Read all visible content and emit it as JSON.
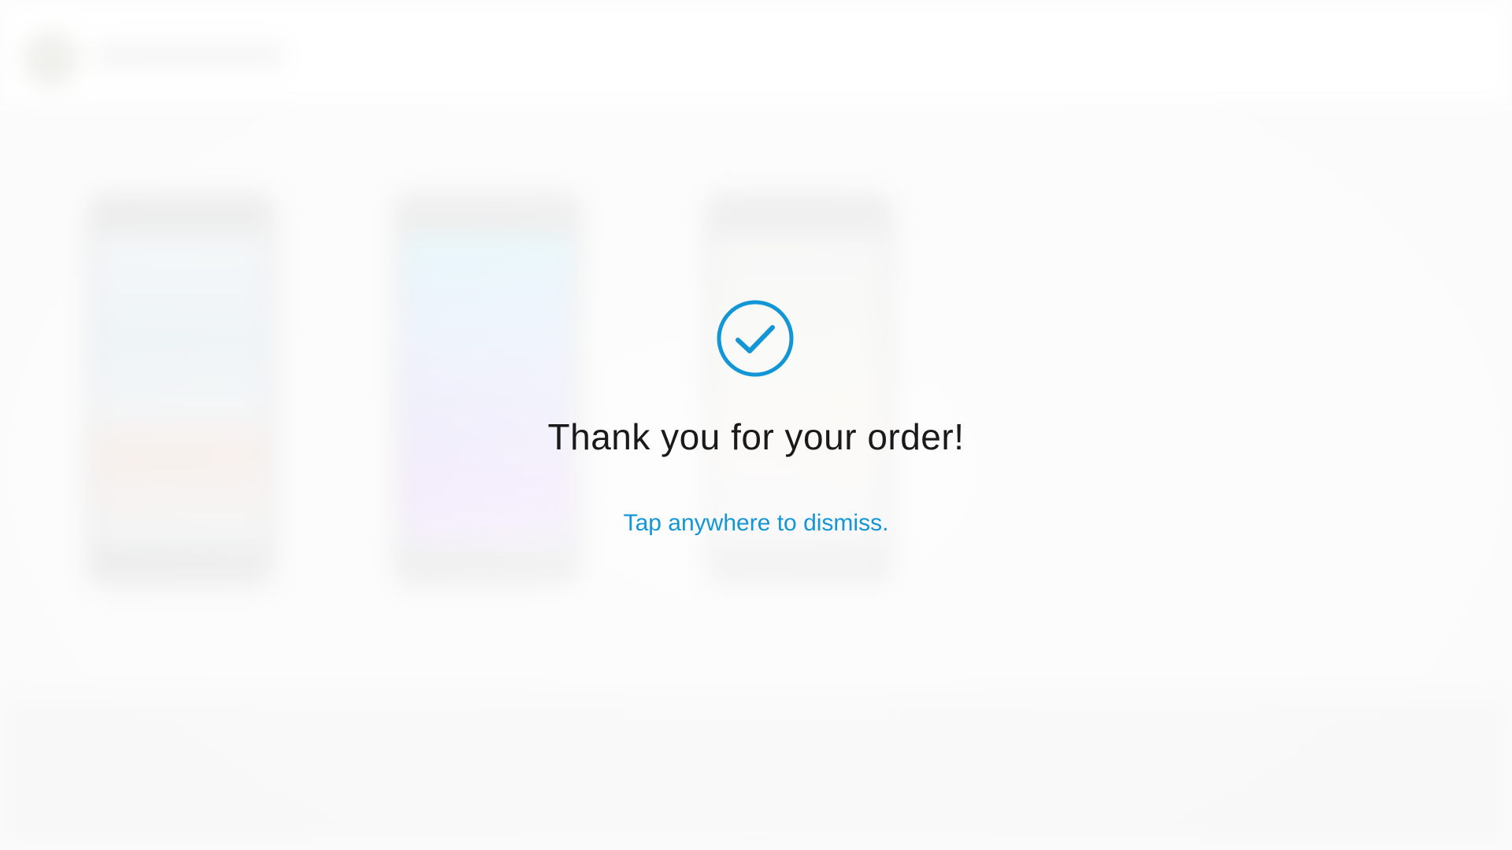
{
  "confirmation": {
    "icon": "check-circle-icon",
    "title": "Thank you for your order!",
    "dismiss_hint": "Tap anywhere to dismiss."
  },
  "colors": {
    "accent": "#1296d6",
    "title_text": "#1a1a1a",
    "background": "#f8f8f8"
  }
}
